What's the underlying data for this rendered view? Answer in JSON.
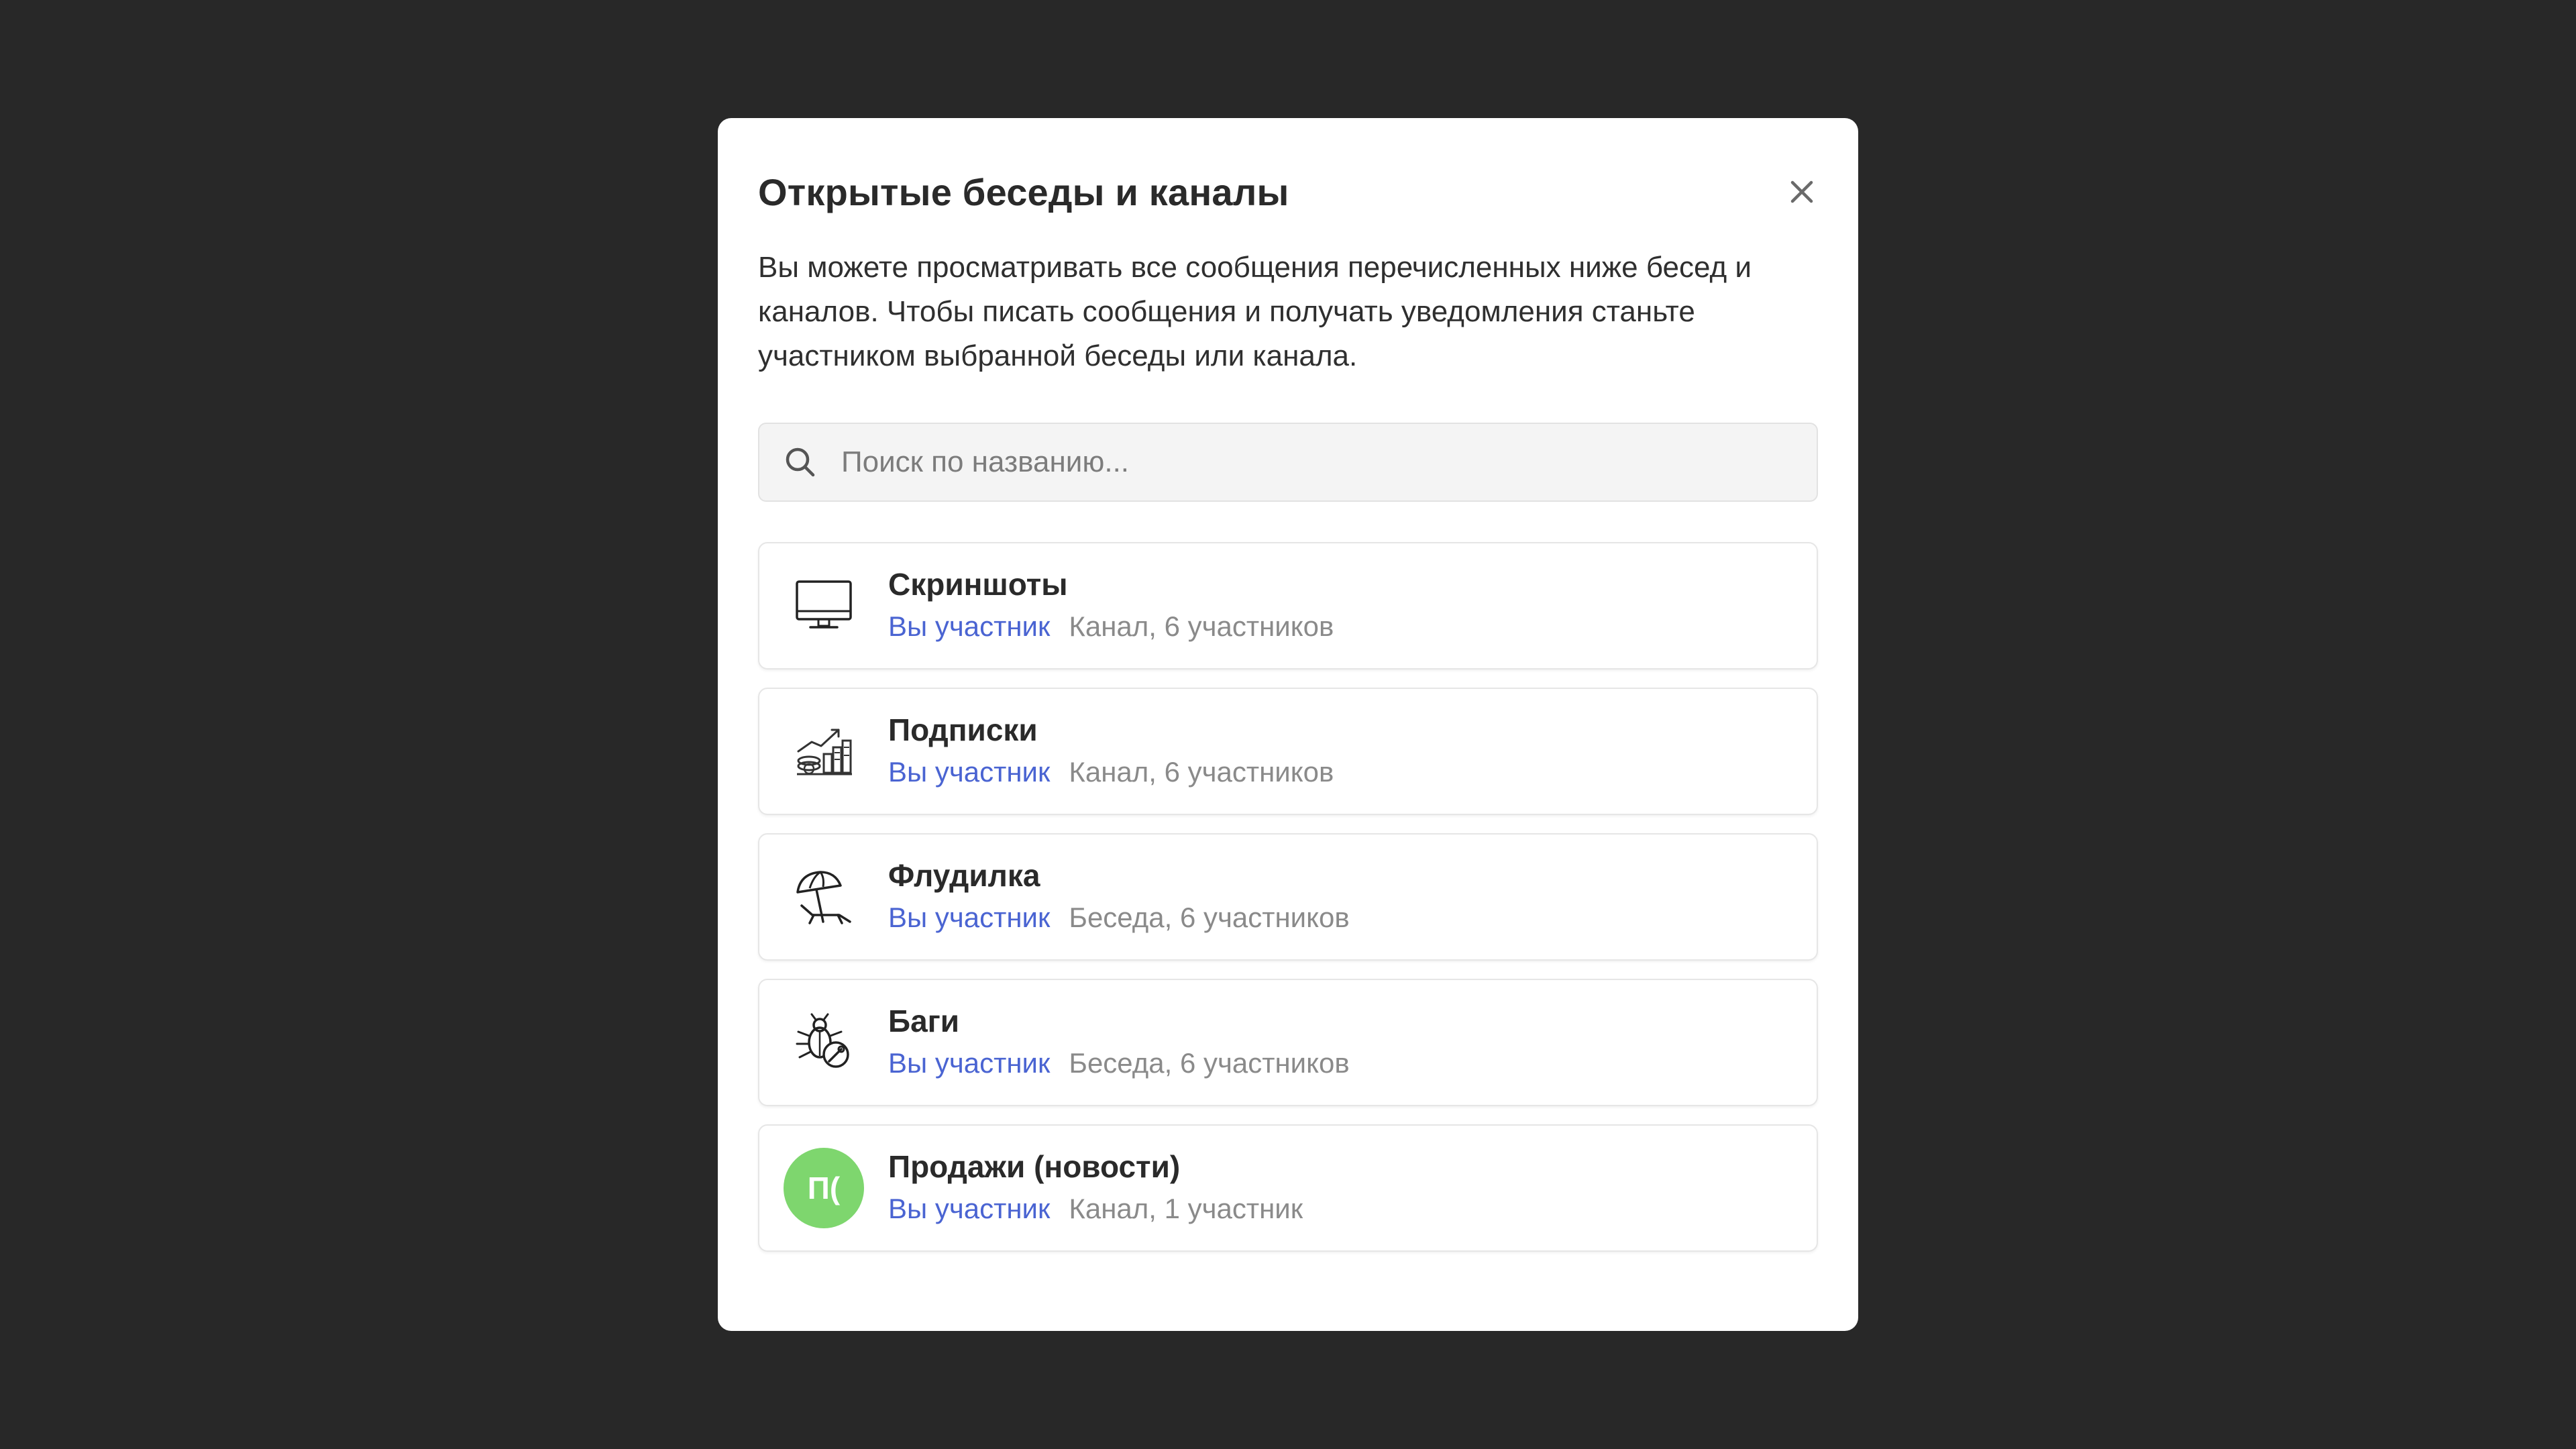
{
  "modal": {
    "title": "Открытые беседы и каналы",
    "description": "Вы можете просматривать все сообщения перечисленных ниже бесед и каналов. Чтобы писать сообщения и получать уведомления станьте участником выбранной беседы или канала.",
    "close_icon": "close-icon"
  },
  "search": {
    "placeholder": "Поиск по названию...",
    "value": "",
    "icon": "search-icon"
  },
  "items": [
    {
      "name": "Скриншоты",
      "member_label": "Вы участник",
      "info": "Канал, 6 участников",
      "icon": "monitor-icon"
    },
    {
      "name": "Подписки",
      "member_label": "Вы участник",
      "info": "Канал, 6 участников",
      "icon": "growth-chart-icon"
    },
    {
      "name": "Флудилка",
      "member_label": "Вы участник",
      "info": "Беседа, 6 участников",
      "icon": "beach-umbrella-icon"
    },
    {
      "name": "Баги",
      "member_label": "Вы участник",
      "info": "Беседа, 6 участников",
      "icon": "bug-icon"
    },
    {
      "name": "Продажи (новости)",
      "member_label": "Вы участник",
      "info": "Канал, 1 участник",
      "avatar_text": "П(",
      "avatar_color": "#7ed66e"
    }
  ],
  "colors": {
    "backdrop": "#282828",
    "member_tag": "#4a64d2",
    "meta_text": "#8a8a8a",
    "avatar_green": "#7ed66e"
  }
}
